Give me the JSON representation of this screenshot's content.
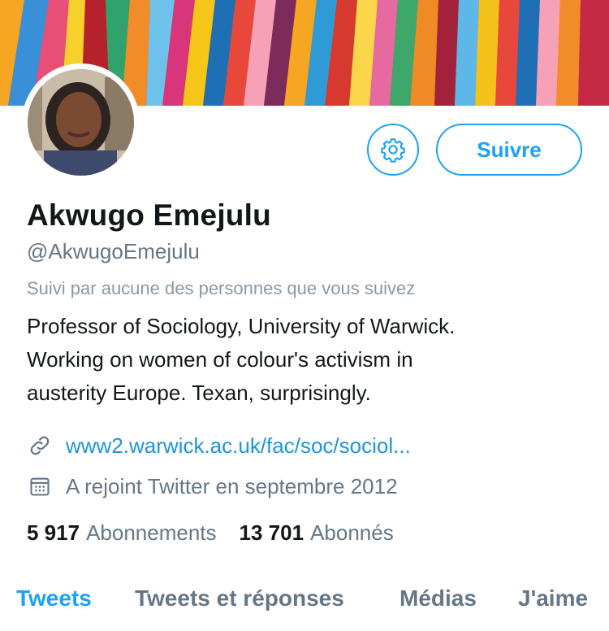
{
  "profile": {
    "name": "Akwugo Emejulu",
    "handle": "@AkwugoEmejulu",
    "followed_by_note": "Suivi par aucune des personnes que vous suivez",
    "bio_lines": [
      "Professor of Sociology, University of Warwick.",
      "Working on women of colour's activism in",
      "austerity Europe. Texan, surprisingly."
    ],
    "website": "www2.warwick.ac.uk/fac/soc/sociol...",
    "joined": "A rejoint Twitter en septembre 2012"
  },
  "actions": {
    "settings_icon": "gear-icon",
    "follow_label": "Suivre"
  },
  "stats": {
    "following_count": "5 917",
    "following_label": "Abonnements",
    "followers_count": "13 701",
    "followers_label": "Abonnés"
  },
  "tabs": [
    {
      "label": "Tweets",
      "active": true
    },
    {
      "label": "Tweets et réponses",
      "active": false
    },
    {
      "label": "Médias",
      "active": false
    },
    {
      "label": "J'aime",
      "active": false
    }
  ],
  "colors": {
    "accent": "#1da1f2",
    "link": "#1b95e0",
    "text_primary": "#14171a",
    "text_secondary": "#657786"
  }
}
